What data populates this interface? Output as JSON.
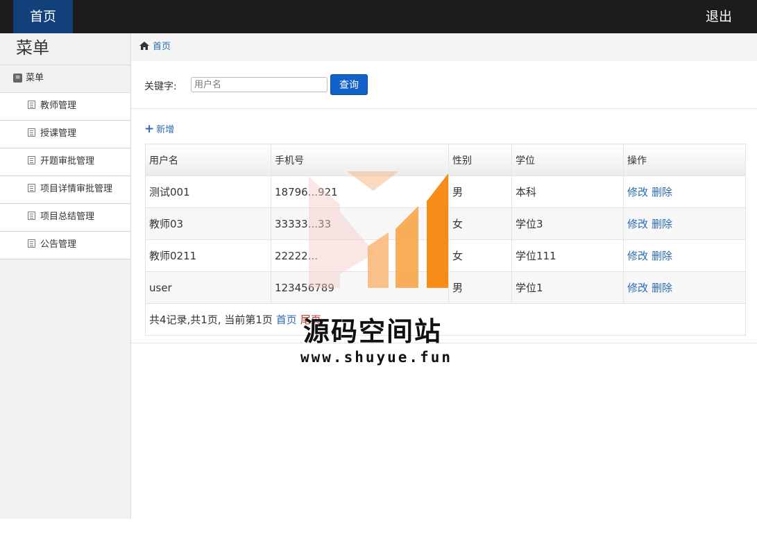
{
  "topbar": {
    "home_label": "首页",
    "logout_label": "退出"
  },
  "sidebar": {
    "title": "菜单",
    "menu_header": "菜单",
    "items": [
      {
        "label": "教师管理"
      },
      {
        "label": "授课管理"
      },
      {
        "label": "开题审批管理"
      },
      {
        "label": "项目详情审批管理"
      },
      {
        "label": "项目总结管理"
      },
      {
        "label": "公告管理"
      }
    ]
  },
  "breadcrumb": {
    "home": "首页"
  },
  "search": {
    "label": "关键字:",
    "placeholder": "用户名",
    "button": "查询"
  },
  "toolbar": {
    "add_label": "新增"
  },
  "table": {
    "headers": [
      "用户名",
      "手机号",
      "性别",
      "学位",
      "操作"
    ],
    "rows": [
      {
        "username": "测试001",
        "phone": "18796...921",
        "gender": "男",
        "degree": "本科",
        "edit": "修改",
        "delete": "删除"
      },
      {
        "username": "教师03",
        "phone": "33333...33",
        "gender": "女",
        "degree": "学位3",
        "edit": "修改",
        "delete": "删除"
      },
      {
        "username": "教师0211",
        "phone": "22222...",
        "gender": "女",
        "degree": "学位111",
        "edit": "修改",
        "delete": "删除"
      },
      {
        "username": "user",
        "phone": "123456789",
        "gender": "男",
        "degree": "学位1",
        "edit": "修改",
        "delete": "删除"
      }
    ]
  },
  "pagination": {
    "summary": "共4记录,共1页, 当前第1页",
    "first": "首页",
    "last": "尾页"
  },
  "watermark": {
    "text": "源码空间站",
    "url": "www.shuyue.fun"
  }
}
